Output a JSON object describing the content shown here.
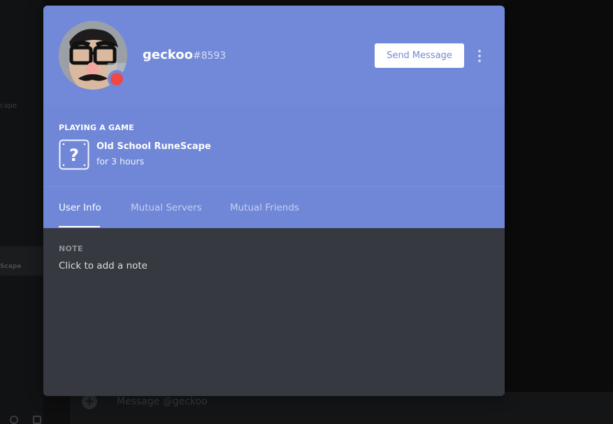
{
  "background": {
    "message_placeholder": "Message @geckoo",
    "sidebar_label": "Scape",
    "sidebar_label_top": "cape"
  },
  "profile": {
    "username": "geckoo",
    "discriminator": "#8593",
    "status": "do-not-disturb",
    "status_color": "#f04747",
    "accent_color": "#7289da",
    "send_message_label": "Send Message",
    "more_icon": "vertical-ellipsis-icon"
  },
  "activity": {
    "heading": "PLAYING A GAME",
    "game_name": "Old School RuneScape",
    "duration": "for 3 hours",
    "game_icon": "unknown-game-question-icon"
  },
  "tabs": [
    {
      "label": "User Info",
      "active": true
    },
    {
      "label": "Mutual Servers",
      "active": false
    },
    {
      "label": "Mutual Friends",
      "active": false
    }
  ],
  "note": {
    "label": "NOTE",
    "placeholder": "Click to add a note"
  }
}
